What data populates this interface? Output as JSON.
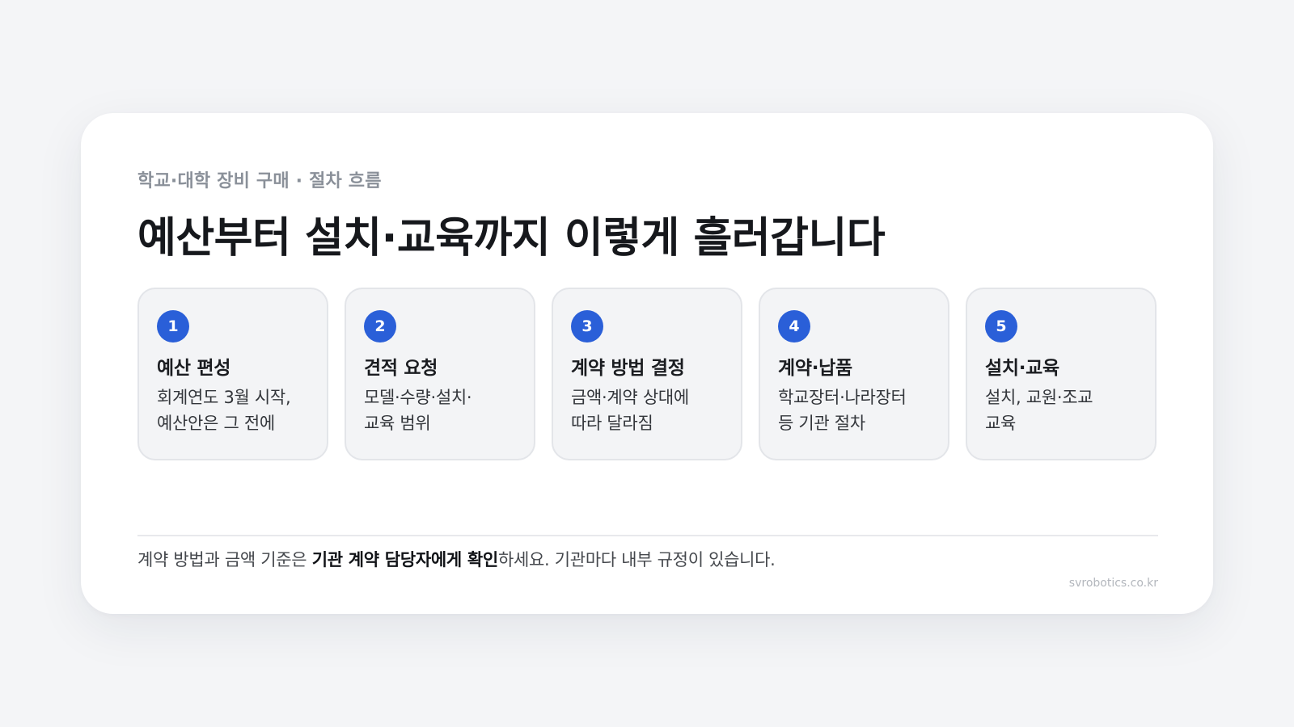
{
  "header": {
    "eyebrow": "학교·대학 장비 구매 · 절차 흐름",
    "title": "예산부터 설치·교육까지 이렇게 흘러갑니다"
  },
  "steps": [
    {
      "number": "1",
      "title": "예산 편성",
      "desc": "회계연도 3월 시작,\n예산안은 그 전에"
    },
    {
      "number": "2",
      "title": "견적 요청",
      "desc": "모델·수량·설치·\n교육 범위"
    },
    {
      "number": "3",
      "title": "계약 방법 결정",
      "desc": "금액·계약 상대에\n따라 달라짐"
    },
    {
      "number": "4",
      "title": "계약·납품",
      "desc": "학교장터·나라장터\n등 기관 절차"
    },
    {
      "number": "5",
      "title": "설치·교육",
      "desc": "설치, 교원·조교\n교육"
    }
  ],
  "note": {
    "before": "계약 방법과 금액 기준은 ",
    "emphasis": "기관 계약 담당자에게 확인",
    "after": "하세요. 기관마다 내부 규정이 있습니다."
  },
  "footer": {
    "site": "svrobotics.co.kr"
  },
  "colors": {
    "accent": "#2a5fd8",
    "background": "#f4f5f7",
    "card": "#ffffff",
    "step_bg": "#f3f4f6"
  }
}
